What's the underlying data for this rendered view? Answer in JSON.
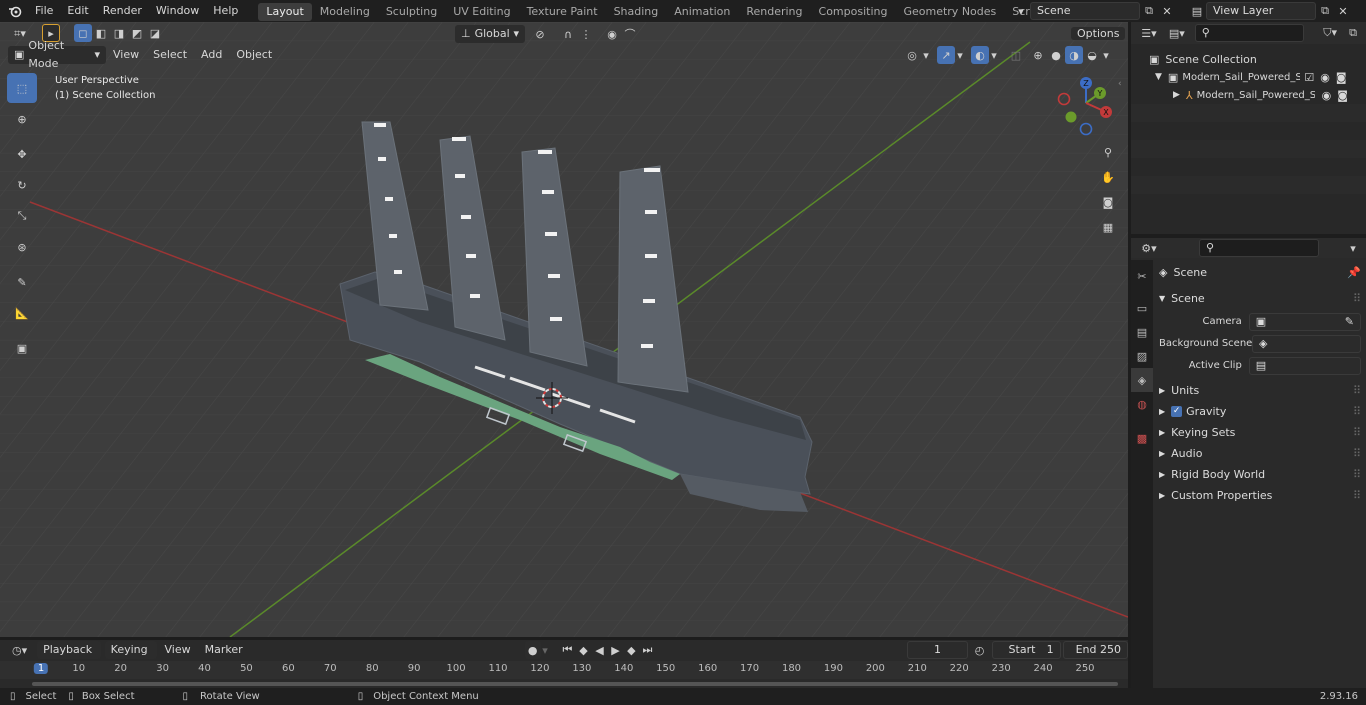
{
  "topbar": {
    "menus": [
      "File",
      "Edit",
      "Render",
      "Window",
      "Help"
    ],
    "workspaces": [
      "Layout",
      "Modeling",
      "Sculpting",
      "UV Editing",
      "Texture Paint",
      "Shading",
      "Animation",
      "Rendering",
      "Compositing",
      "Geometry Nodes",
      "Scripting"
    ],
    "active_workspace": "Layout",
    "scene_value": "Scene",
    "view_layer_value": "View Layer"
  },
  "viewport": {
    "mode": "Object Mode",
    "menus": [
      "View",
      "Select",
      "Add",
      "Object"
    ],
    "orientation": "Global",
    "options_label": "Options",
    "overlay_title": "User Perspective",
    "overlay_subtitle": "(1) Scene Collection",
    "gizmo_axes": [
      "Z",
      "Y",
      "X"
    ]
  },
  "outliner": {
    "root": "Scene Collection",
    "items": [
      "Modern_Sail_Powered_Sea_V",
      "Modern_Sail_Powered_Se"
    ]
  },
  "properties": {
    "context": "Scene",
    "panel": "Scene",
    "fields": [
      {
        "label": "Camera",
        "value": ""
      },
      {
        "label": "Background Scene",
        "value": ""
      },
      {
        "label": "Active Clip",
        "value": ""
      }
    ],
    "sections": [
      "Units",
      "Gravity",
      "Keying Sets",
      "Audio",
      "Rigid Body World",
      "Custom Properties"
    ],
    "gravity_checked": true
  },
  "timeline": {
    "menus": [
      "Playback",
      "Keying",
      "View",
      "Marker"
    ],
    "current_frame": "1",
    "start_label": "Start",
    "start_value": "1",
    "end_label": "End",
    "end_value": "250",
    "ticks": [
      "1",
      "10",
      "20",
      "30",
      "40",
      "50",
      "60",
      "70",
      "80",
      "90",
      "100",
      "110",
      "120",
      "130",
      "140",
      "150",
      "160",
      "170",
      "180",
      "190",
      "200",
      "210",
      "220",
      "230",
      "240",
      "250"
    ]
  },
  "statusbar": {
    "items": [
      "Select",
      "Box Select",
      "Rotate View",
      "Object Context Menu"
    ],
    "version": "2.93.16"
  },
  "colors": {
    "accent": "#4772b3",
    "viewport_bg": "#3c3c3c",
    "axis_x": "#c23a3a",
    "axis_y": "#6b9b2b",
    "hull": "#4a5059",
    "stripe": "#6aa47f"
  }
}
